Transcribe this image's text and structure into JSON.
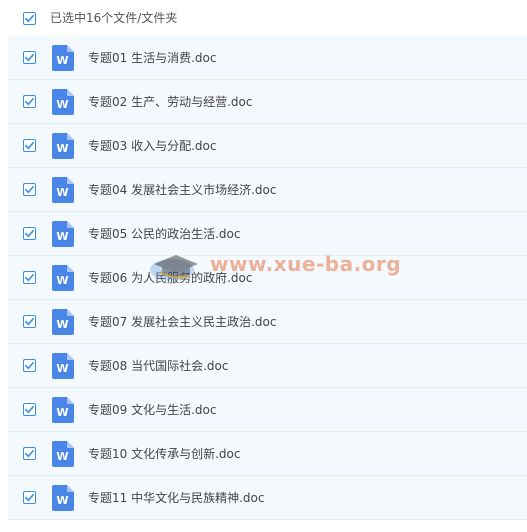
{
  "header": {
    "selected_text": "已选中16个文件/文件夹",
    "checked": true
  },
  "files": [
    {
      "name": "专题01 生活与消费.doc",
      "checked": true,
      "icon": "word-doc-icon"
    },
    {
      "name": "专题02 生产、劳动与经营.doc",
      "checked": true,
      "icon": "word-doc-icon"
    },
    {
      "name": "专题03 收入与分配.doc",
      "checked": true,
      "icon": "word-doc-icon"
    },
    {
      "name": "专题04 发展社会主义市场经济.doc",
      "checked": true,
      "icon": "word-doc-icon"
    },
    {
      "name": "专题05 公民的政治生活.doc",
      "checked": true,
      "icon": "word-doc-icon"
    },
    {
      "name": "专题06 为人民服务的政府.doc",
      "checked": true,
      "icon": "word-doc-icon"
    },
    {
      "name": "专题07 发展社会主义民主政治.doc",
      "checked": true,
      "icon": "word-doc-icon"
    },
    {
      "name": "专题08 当代国际社会.doc",
      "checked": true,
      "icon": "word-doc-icon"
    },
    {
      "name": "专题09 文化与生活.doc",
      "checked": true,
      "icon": "word-doc-icon"
    },
    {
      "name": "专题10 文化传承与创新.doc",
      "checked": true,
      "icon": "word-doc-icon"
    },
    {
      "name": "专题11 中华文化与民族精神.doc",
      "checked": true,
      "icon": "word-doc-icon"
    }
  ],
  "icon_letter": "W",
  "watermark": {
    "text": "www.xue-ba.org"
  },
  "colors": {
    "accent": "#3a8ee6",
    "row_bg": "#f4f9fd",
    "word_icon": "#4a86e8",
    "watermark": "#e87446"
  }
}
